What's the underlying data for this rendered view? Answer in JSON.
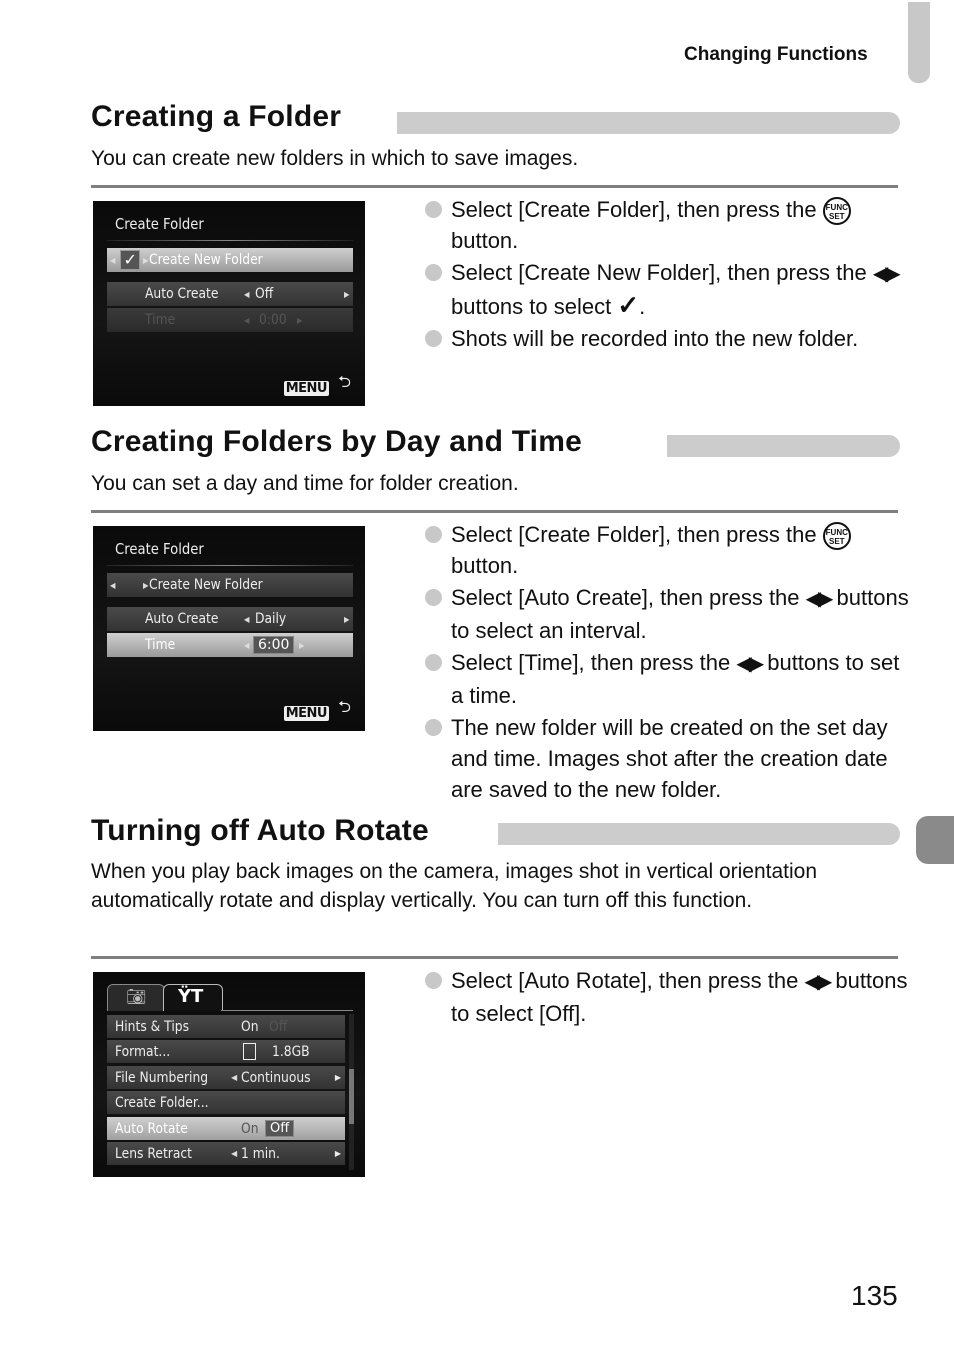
{
  "running_head": "Changing Functions",
  "page_number": "135",
  "sections": [
    {
      "title": "Creating a Folder",
      "intro": "You can create new folders in which to save images.",
      "bullets": [
        {
          "pre": "Select [Create Folder], then press the",
          "icon": "func-set-button-icon",
          "post": "button."
        },
        {
          "pre": "Select [Create New Folder], then press the",
          "icon": "left-right-buttons-icon",
          "post": "buttons to select",
          "icon2": "checkmark-icon",
          "end": "."
        },
        {
          "pre": "Shots will be recorded into the new folder."
        }
      ],
      "screen": {
        "title": "Create Folder",
        "rows": [
          {
            "label": "Create New Folder",
            "value": "",
            "checked": true,
            "state": "selected"
          },
          {
            "label": "Auto Create",
            "value": "Off",
            "state": "normal"
          },
          {
            "label": "Time",
            "value": "0:00",
            "state": "disabled"
          }
        ],
        "menu_label": "MENU",
        "back_icon": "return-icon"
      }
    },
    {
      "title": "Creating Folders by Day and Time",
      "intro": "You can set a day and time for folder creation.",
      "bullets": [
        {
          "pre": "Select [Create Folder], then press the",
          "icon": "func-set-button-icon",
          "post": "button."
        },
        {
          "pre": "Select [Auto Create], then press the",
          "icon": "left-right-buttons-icon",
          "post": "buttons to select an interval."
        },
        {
          "pre": "Select [Time], then press the",
          "icon": "left-right-buttons-icon",
          "post": "buttons to set a time."
        },
        {
          "pre": "The new folder will be created on the set day and time. Images shot after the creation date are saved to the new folder."
        }
      ],
      "screen": {
        "title": "Create Folder",
        "rows": [
          {
            "label": "Create New Folder",
            "value": "",
            "checked": false,
            "state": "normal"
          },
          {
            "label": "Auto Create",
            "value": "Daily",
            "state": "normal"
          },
          {
            "label": "Time",
            "value": "6:00",
            "state": "selected"
          }
        ],
        "menu_label": "MENU",
        "back_icon": "return-icon"
      }
    },
    {
      "title": "Turning off Auto Rotate",
      "intro": "When you play back images on the camera, images shot in vertical orientation automatically rotate and display vertically. You can turn off this function.",
      "bullets": [
        {
          "pre": "Select [Auto Rotate], then press the",
          "icon": "left-right-buttons-icon",
          "post": "buttons to select [Off]."
        }
      ],
      "screen": {
        "tabs": [
          {
            "icon": "camera-icon",
            "active": false
          },
          {
            "icon": "tools-icon",
            "active": true
          }
        ],
        "rows": [
          {
            "label": "Hints & Tips",
            "value": "On",
            "value_alt": "Off"
          },
          {
            "label": "Format...",
            "value": "1.8GB",
            "icon": "memory-card-icon"
          },
          {
            "label": "File Numbering",
            "value": "Continuous"
          },
          {
            "label": "Create Folder..."
          },
          {
            "label": "Auto Rotate",
            "value": "On",
            "value_alt": "Off",
            "selected": true
          },
          {
            "label": "Lens Retract",
            "value": "1 min."
          }
        ]
      }
    }
  ]
}
